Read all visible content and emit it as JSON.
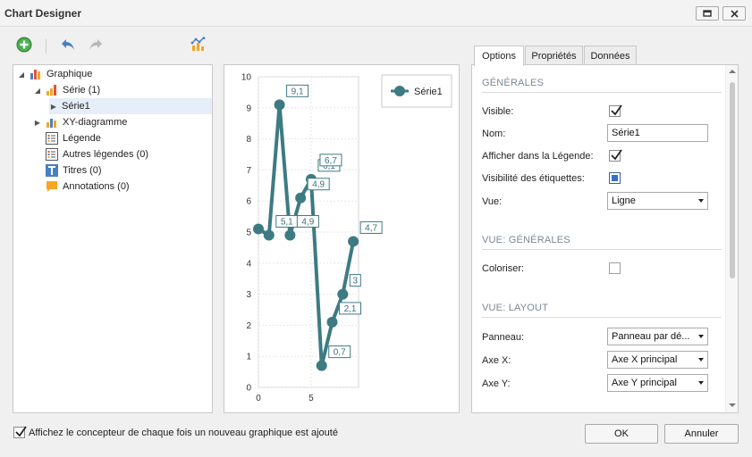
{
  "window": {
    "title": "Chart Designer",
    "restore_icon": "restore-icon",
    "close_icon": "close-icon"
  },
  "toolbar": {
    "add_icon": "add-icon",
    "undo_icon": "undo-icon",
    "redo_icon": "redo-icon",
    "wizard_icon": "chart-wizard-icon"
  },
  "tree": {
    "items": [
      {
        "label": "Graphique",
        "icon": "chart-icon",
        "expanded": true
      },
      {
        "label": "Série (1)",
        "icon": "series-icon",
        "expanded": true
      },
      {
        "label": "Série1",
        "icon": "",
        "selected": true
      },
      {
        "label": "XY-diagramme",
        "icon": "diagram-icon",
        "expanded": false
      },
      {
        "label": "Légende",
        "icon": "legend-icon"
      },
      {
        "label": "Autres légendes (0)",
        "icon": "legend-icon"
      },
      {
        "label": "Titres (0)",
        "icon": "title-icon"
      },
      {
        "label": "Annotations (0)",
        "icon": "annotation-icon"
      }
    ]
  },
  "chart_data": {
    "type": "line",
    "series": [
      {
        "name": "Série1",
        "color": "#3d7b83",
        "points": [
          {
            "x": 0,
            "y": 5.1,
            "label": ""
          },
          {
            "x": 1,
            "y": 4.9,
            "label": "5,1"
          },
          {
            "x": 2,
            "y": 9.1,
            "label": "9,1"
          },
          {
            "x": 3,
            "y": 4.9,
            "label": "4,9"
          },
          {
            "x": 4,
            "y": 6.1,
            "label": "4,9"
          },
          {
            "x": 5,
            "y": 6.7,
            "label": "6,1"
          },
          {
            "x": 6,
            "y": 0.7,
            "label": "0,7"
          },
          {
            "x": 7,
            "y": 2.1,
            "label": "2,1"
          },
          {
            "x": 8,
            "y": 3.0,
            "label": "3"
          },
          {
            "x": 9,
            "y": 4.7,
            "label": "4,7"
          }
        ],
        "extra_label": "6,7"
      }
    ],
    "xlim": [
      0,
      9.5
    ],
    "ylim": [
      0,
      10
    ],
    "yticks": [
      "0",
      "1",
      "2",
      "3",
      "4",
      "5",
      "6",
      "7",
      "8",
      "9",
      "10"
    ],
    "xticks": [
      "0",
      "5"
    ],
    "grid": true,
    "legend_placement": "top-right",
    "legend_label": "Série1"
  },
  "tabs": [
    {
      "label": "Options",
      "active": true
    },
    {
      "label": "Propriétés",
      "active": false
    },
    {
      "label": "Données",
      "active": false
    }
  ],
  "props": {
    "sec_general": "GÉNÉRALES",
    "visible_label": "Visible:",
    "visible_checked": true,
    "name_label": "Nom:",
    "name_value": "Série1",
    "show_legend_label": "Afficher dans la Légende:",
    "show_legend_checked": true,
    "labels_visibility_label": "Visibilité des étiquettes:",
    "view_label": "Vue:",
    "view_value": "Ligne",
    "sec_view_general": "VUE: GÉNÉRALES",
    "colorize_label": "Coloriser:",
    "colorize_checked": false,
    "sec_view_layout": "VUE: LAYOUT",
    "pane_label": "Panneau:",
    "pane_value": "Panneau par dé...",
    "axis_x_label": "Axe X:",
    "axis_x_value": "Axe X principal",
    "axis_y_label": "Axe Y:",
    "axis_y_value": "Axe Y principal"
  },
  "footer": {
    "checkbox_label": "Affichez le concepteur de chaque fois un nouveau graphique est ajouté",
    "checkbox_checked": true,
    "ok_label": "OK",
    "cancel_label": "Annuler"
  }
}
